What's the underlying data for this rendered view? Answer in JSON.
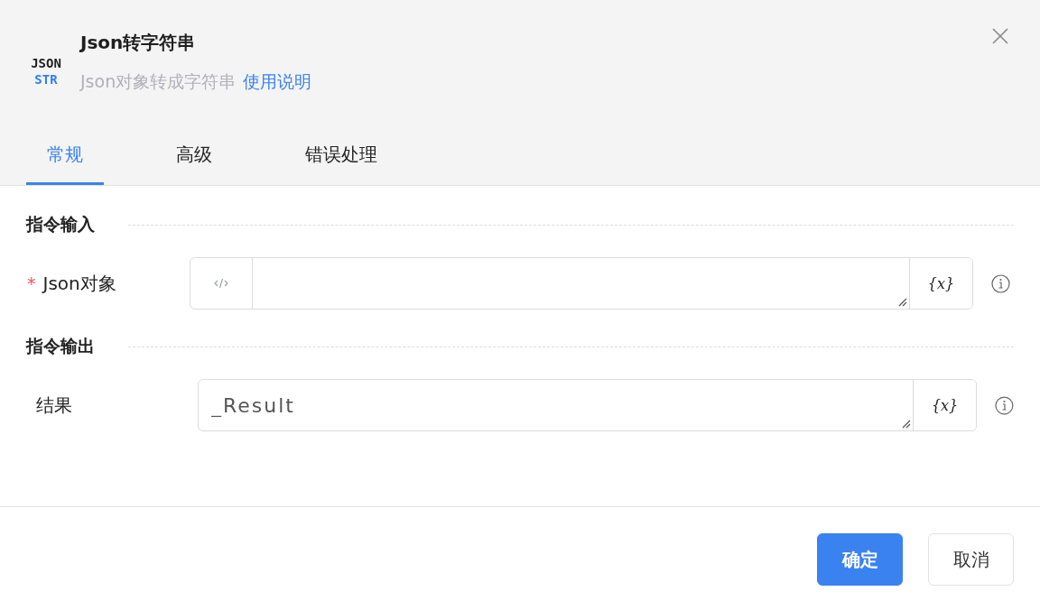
{
  "dialog": {
    "logo": [
      "JSON",
      "STR"
    ],
    "title": "Json转字符串",
    "subtitle": "Json对象转成字符串",
    "help_link": "使用说明"
  },
  "tabs": [
    {
      "label": "常规",
      "selected": true
    },
    {
      "label": "高级",
      "selected": false
    },
    {
      "label": "错误处理",
      "selected": false
    }
  ],
  "sections": [
    {
      "title": "指令输入",
      "fields": [
        {
          "label": "Json对象",
          "required_mark": "*",
          "code_toggle": true,
          "variable_button": "{x}"
        }
      ]
    },
    {
      "title": "指令输出",
      "fields": [
        {
          "label": "结果",
          "code_toggle": false,
          "value": "_Result",
          "variable_button": "{x}"
        }
      ]
    }
  ],
  "buttons": [
    {
      "label": "确定",
      "kind": "primary"
    },
    {
      "label": "取消",
      "kind": "secondary"
    }
  ]
}
